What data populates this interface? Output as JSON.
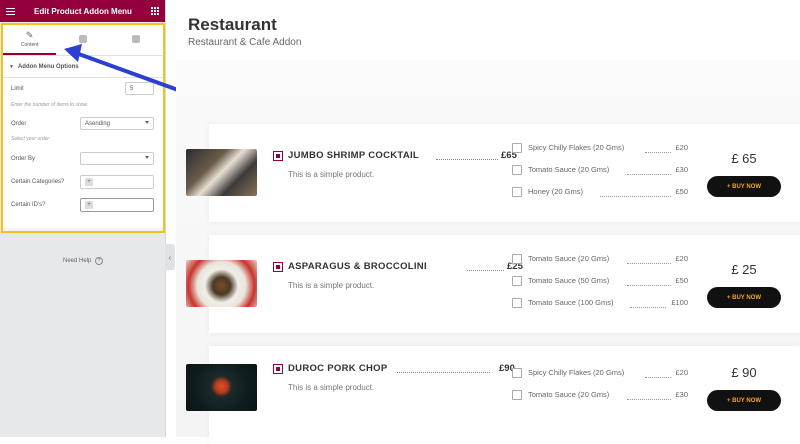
{
  "editor": {
    "title": "Edit Product Addon Menu",
    "tabs": [
      {
        "label": "Content"
      },
      {
        "label": ""
      },
      {
        "label": ""
      }
    ],
    "section_title": "Addon Menu Options",
    "controls": {
      "limit_label": "Limit",
      "limit_value": "5",
      "limit_desc": "Enter the number of items to show.",
      "order_label": "Order",
      "order_value": "Asending",
      "order_desc": "Select your order.",
      "order_by_label": "Order By",
      "order_by_value": "",
      "categories_label": "Certain Categories?",
      "ids_label": "Certain ID's?"
    },
    "help": "Need Help",
    "accent": "#93003c",
    "highlight": "#f0c419"
  },
  "page": {
    "title": "Restaurant",
    "subtitle": "Restaurant & Cafe Addon"
  },
  "products": [
    {
      "name": "JUMBO SHRIMP COCKTAIL",
      "price": "£65",
      "desc": "This is a simple product.",
      "total": "£ 65",
      "buy": "+ BUY NOW",
      "addons": [
        {
          "name": "Spicy Chilly Flakes (20 Gms)",
          "price": "£20"
        },
        {
          "name": "Tomato Sauce (20 Gms)",
          "price": "£30"
        },
        {
          "name": "Honey (20 Gms)",
          "price": "£50"
        }
      ]
    },
    {
      "name": "ASPARAGUS & BROCCOLINI",
      "price": "£25",
      "desc": "This is a simple product.",
      "total": "£ 25",
      "buy": "+ BUY NOW",
      "addons": [
        {
          "name": "Tomato Sauce (20 Gms)",
          "price": "£20"
        },
        {
          "name": "Tomato Sauce (50 Gms)",
          "price": "£50"
        },
        {
          "name": "Tomato Sauce (100 Gms)",
          "price": "£100"
        }
      ]
    },
    {
      "name": "DUROC PORK CHOP",
      "price": "£90",
      "desc": "This is a simple product.",
      "total": "£ 90",
      "buy": "+ BUY NOW",
      "addons": [
        {
          "name": "Spicy Chilly Flakes (20 Gms)",
          "price": "£20"
        },
        {
          "name": "Tomato Sauce (20 Gms)",
          "price": "£30"
        }
      ]
    }
  ]
}
